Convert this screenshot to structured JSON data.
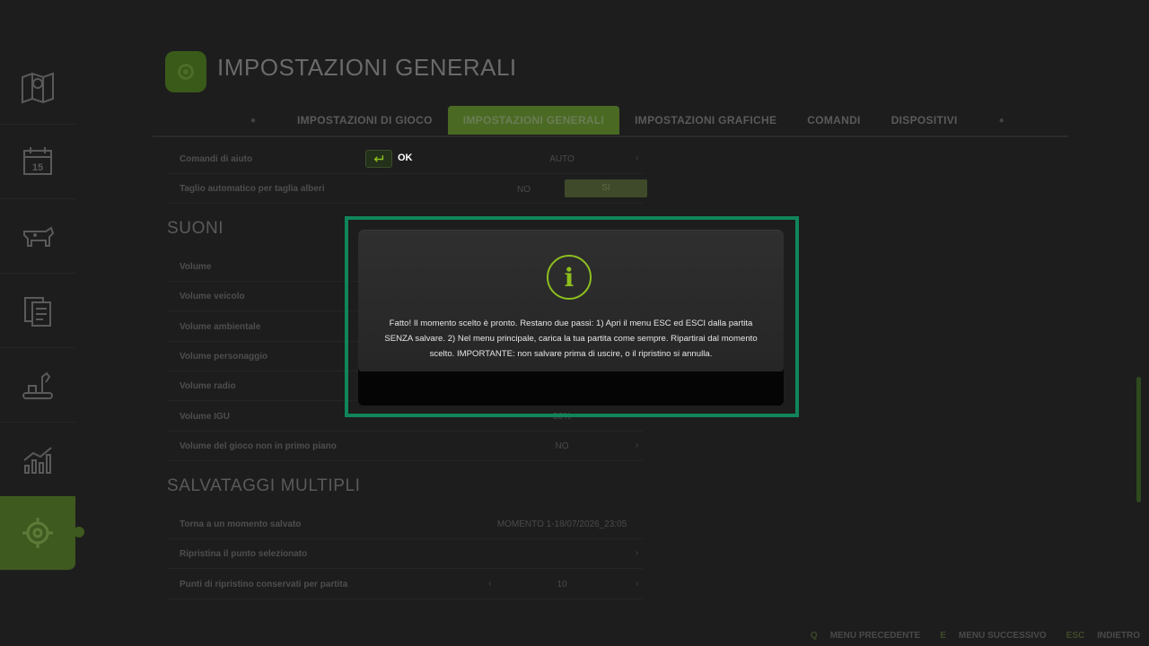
{
  "header": {
    "title": "IMPOSTAZIONI GENERALI"
  },
  "tabs": [
    {
      "label": "IMPOSTAZIONI DI GIOCO"
    },
    {
      "label": "IMPOSTAZIONI GENERALI"
    },
    {
      "label": "IMPOSTAZIONI GRAFICHE"
    },
    {
      "label": "COMANDI"
    },
    {
      "label": "DISPOSITIVI"
    }
  ],
  "settings": {
    "aid_controls": {
      "label": "Comandi di aiuto",
      "value": "AUTO"
    },
    "auto_tree_cut": {
      "label": "Taglio automatico per taglia alberi",
      "no": "NO",
      "yes": "SI"
    },
    "sounds_title": "SUONI",
    "volume": {
      "label": "Volume"
    },
    "vehicle_volume": {
      "label": "Volume veicolo"
    },
    "ambient_volume": {
      "label": "Volume ambientale"
    },
    "character_volume": {
      "label": "Volume personaggio"
    },
    "radio_volume": {
      "label": "Volume radio"
    },
    "igu_volume": {
      "label": "Volume IGU",
      "value": "80%"
    },
    "background_volume": {
      "label": "Volume del gioco non in primo piano",
      "value": "NO"
    },
    "multisave_title": "SALVATAGGI MULTIPLI",
    "go_back_moment": {
      "label": "Torna a un momento salvato",
      "value": "MOMENTO 1-18/07/2026_23:05"
    },
    "restore_point": {
      "label": "Ripristina il punto selezionato",
      "value": ""
    },
    "points_kept": {
      "label": "Punti di ripristino conservati per partita",
      "value": "10"
    }
  },
  "dialog": {
    "message": "Fatto! Il momento scelto è pronto. Restano due passi: 1) Apri il menu ESC ed ESCI dalla partita SENZA salvare. 2) Nel menu principale, carica la tua partita come sempre. Ripartirai dal momento scelto. IMPORTANTE: non salvare prima di uscire, o il ripristino si annulla.",
    "icon_glyph": "i",
    "ok_label": "OK"
  },
  "footer": {
    "prev": {
      "key": "Q",
      "label": "MENU PRECEDENTE"
    },
    "next": {
      "key": "E",
      "label": "MENU SUCCESSIVO"
    },
    "back": {
      "key": "ESC",
      "label": "INDIETRO"
    }
  },
  "colors": {
    "accent": "#8dbf1e",
    "highlight": "#10855a",
    "tab_active": "#4a6a24"
  }
}
